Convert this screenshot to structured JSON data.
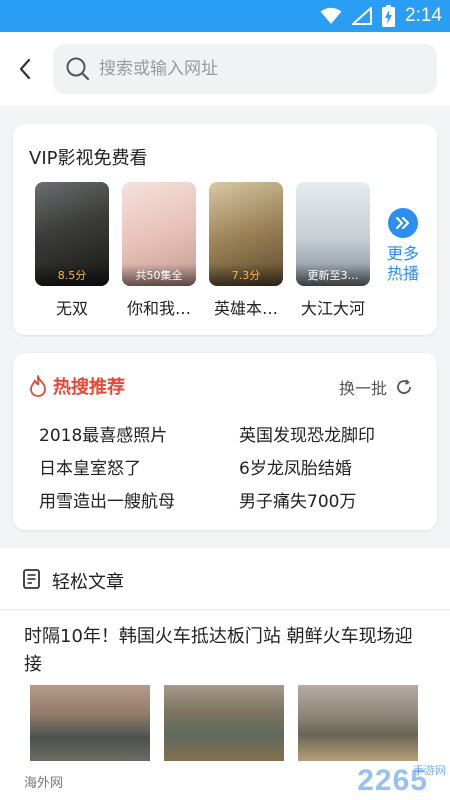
{
  "status_bar": {
    "time": "2:14",
    "color": "#2a9df4",
    "icons": [
      "wifi-icon",
      "signal-icon",
      "battery-charging-icon"
    ]
  },
  "header": {
    "back_icon": "chevron-left-icon",
    "search_placeholder": "搜索或输入网址"
  },
  "vip": {
    "title": "VIP影视免费看",
    "movies": [
      {
        "title": "无双",
        "badge": "8.5分",
        "badge_type": "score"
      },
      {
        "title": "你和我…",
        "badge": "共50集全",
        "badge_type": "episodes"
      },
      {
        "title": "英雄本…",
        "badge": "7.3分",
        "badge_type": "score"
      },
      {
        "title": "大江大河",
        "badge": "更新至3…",
        "badge_type": "episodes"
      }
    ],
    "more_label_line1": "更多",
    "more_label_line2": "热播"
  },
  "hot_search": {
    "title": "热搜推荐",
    "refresh_label": "换一批",
    "items": [
      "2018最喜感照片",
      "英国发现恐龙脚印",
      "日本皇室怒了",
      "6岁龙凤胎结婚",
      "用雪造出一艘航母",
      "男子痛失700万"
    ]
  },
  "articles_section": {
    "title": "轻松文章"
  },
  "article": {
    "title": "时隔10年！韩国火车抵达板门站 朝鲜火车现场迎接",
    "source": "海外网"
  },
  "watermark": {
    "text": "2265",
    "sub": "手游网"
  },
  "colors": {
    "accent": "#2a8ef2",
    "hot_red": "#e24a37"
  }
}
